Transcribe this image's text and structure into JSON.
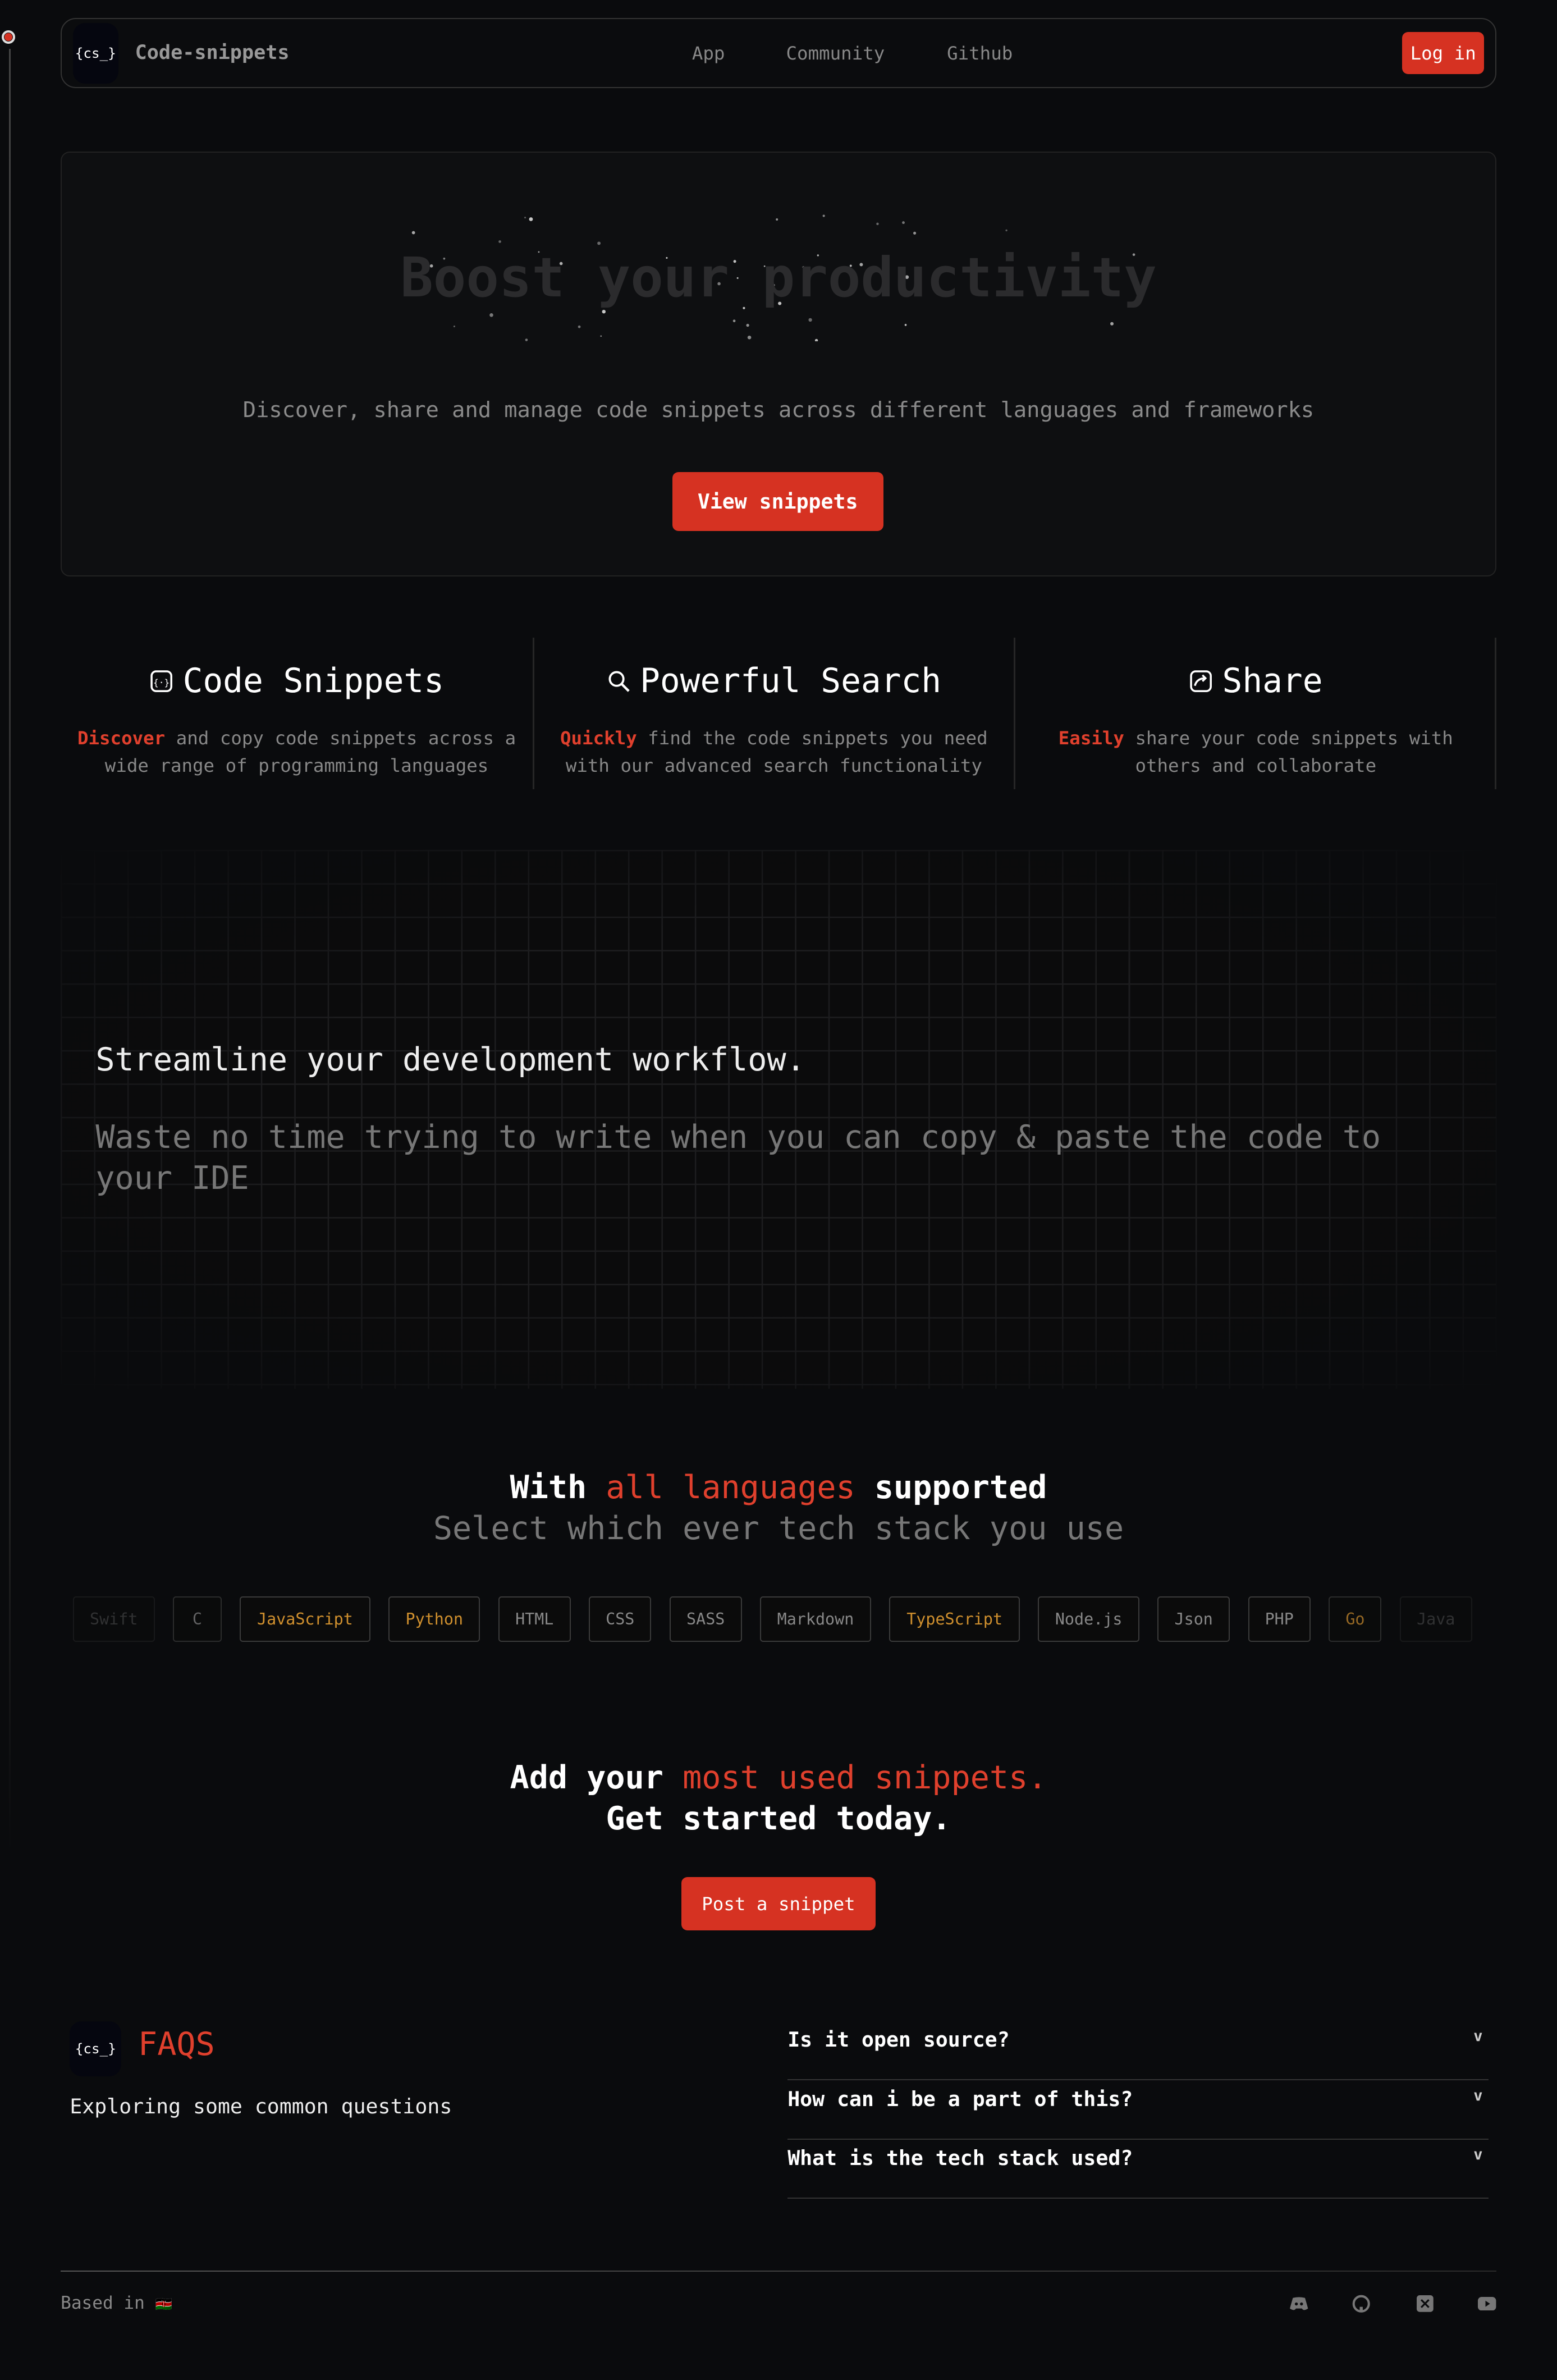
{
  "nav": {
    "brand": "Code-snippets",
    "logo": "{cs_}",
    "links": [
      "App",
      "Community",
      "Github"
    ],
    "login": "Log in"
  },
  "hero": {
    "title": "Boost your productivity",
    "subtitle": "Discover, share and manage code snippets across different languages and frameworks",
    "cta": "View snippets"
  },
  "features": [
    {
      "icon": "code-icon",
      "title": "Code Snippets",
      "highlight": "Discover",
      "text": " and copy code snippets across a wide range of programming languages"
    },
    {
      "icon": "search-icon",
      "title": "Powerful Search",
      "highlight": "Quickly",
      "text": " find the code snippets you need with our advanced search functionality"
    },
    {
      "icon": "share-icon",
      "title": "Share",
      "highlight": "Easily",
      "text": " share your code snippets with others and collaborate"
    }
  ],
  "workflow": {
    "title": "Streamline your development workflow.",
    "text": "Waste no time trying to write when you can copy & paste the code to your IDE"
  },
  "languages": {
    "pre": "With ",
    "accent": "all languages",
    "post": " supported",
    "sub": "Select which ever tech stack you use",
    "items": [
      "Swift",
      "C",
      "JavaScript",
      "Python",
      "HTML",
      "CSS",
      "SASS",
      "Markdown",
      "TypeScript",
      "Node.js",
      "Json",
      "PHP",
      "Go",
      "Java"
    ],
    "highlighted": [
      "JavaScript",
      "Python",
      "TypeScript",
      "Go"
    ]
  },
  "cta": {
    "pre": "Add your ",
    "accent": "most used snippets.",
    "line2": "Get started today.",
    "button": "Post a snippet"
  },
  "faq": {
    "logo": "{cs_}",
    "title": "FAQS",
    "subtitle": "Exploring some common questions",
    "questions": [
      "Is it open source?",
      "How can i be a part of this?",
      "What is the tech stack used?"
    ]
  },
  "footer": {
    "based": "Based in",
    "flag": "🇰🇪",
    "icons": [
      "discord-icon",
      "github-icon",
      "x-icon",
      "youtube-icon"
    ]
  },
  "colors": {
    "accent": "#d63222",
    "highlight": "#d0902e",
    "background": "#0a0b0d"
  }
}
